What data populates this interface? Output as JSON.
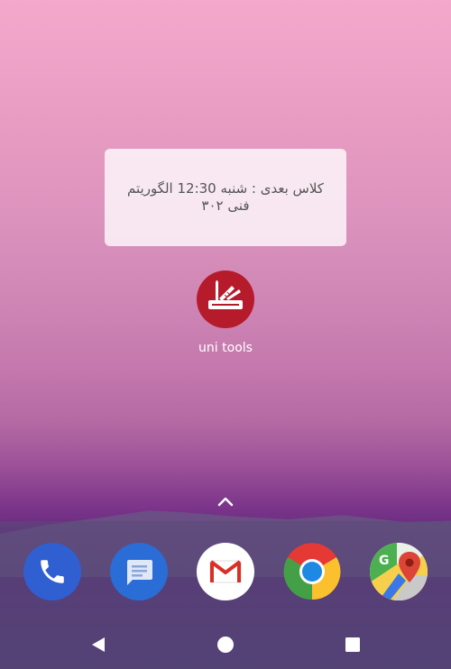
{
  "home": {
    "widget": {
      "line1": "کلاس بعدی : شنبه 12:30 الگوریتم",
      "line2": "فنی ۳۰۲"
    },
    "app_unitools": {
      "label": "uni tools"
    }
  },
  "dock": {
    "apps": [
      {
        "name": "Phone",
        "icon": "phone-icon"
      },
      {
        "name": "Messages",
        "icon": "messages-icon"
      },
      {
        "name": "Gmail",
        "icon": "gmail-icon"
      },
      {
        "name": "Chrome",
        "icon": "chrome-icon"
      },
      {
        "name": "Maps",
        "icon": "maps-icon"
      }
    ]
  },
  "colors": {
    "unitools_bg": "#b51b2a",
    "phone_bg": "#2f5fd1",
    "messages_bg": "#2a6dd6"
  },
  "navbar": {
    "back": "back-icon",
    "home": "home-icon",
    "recents": "recents-icon"
  }
}
